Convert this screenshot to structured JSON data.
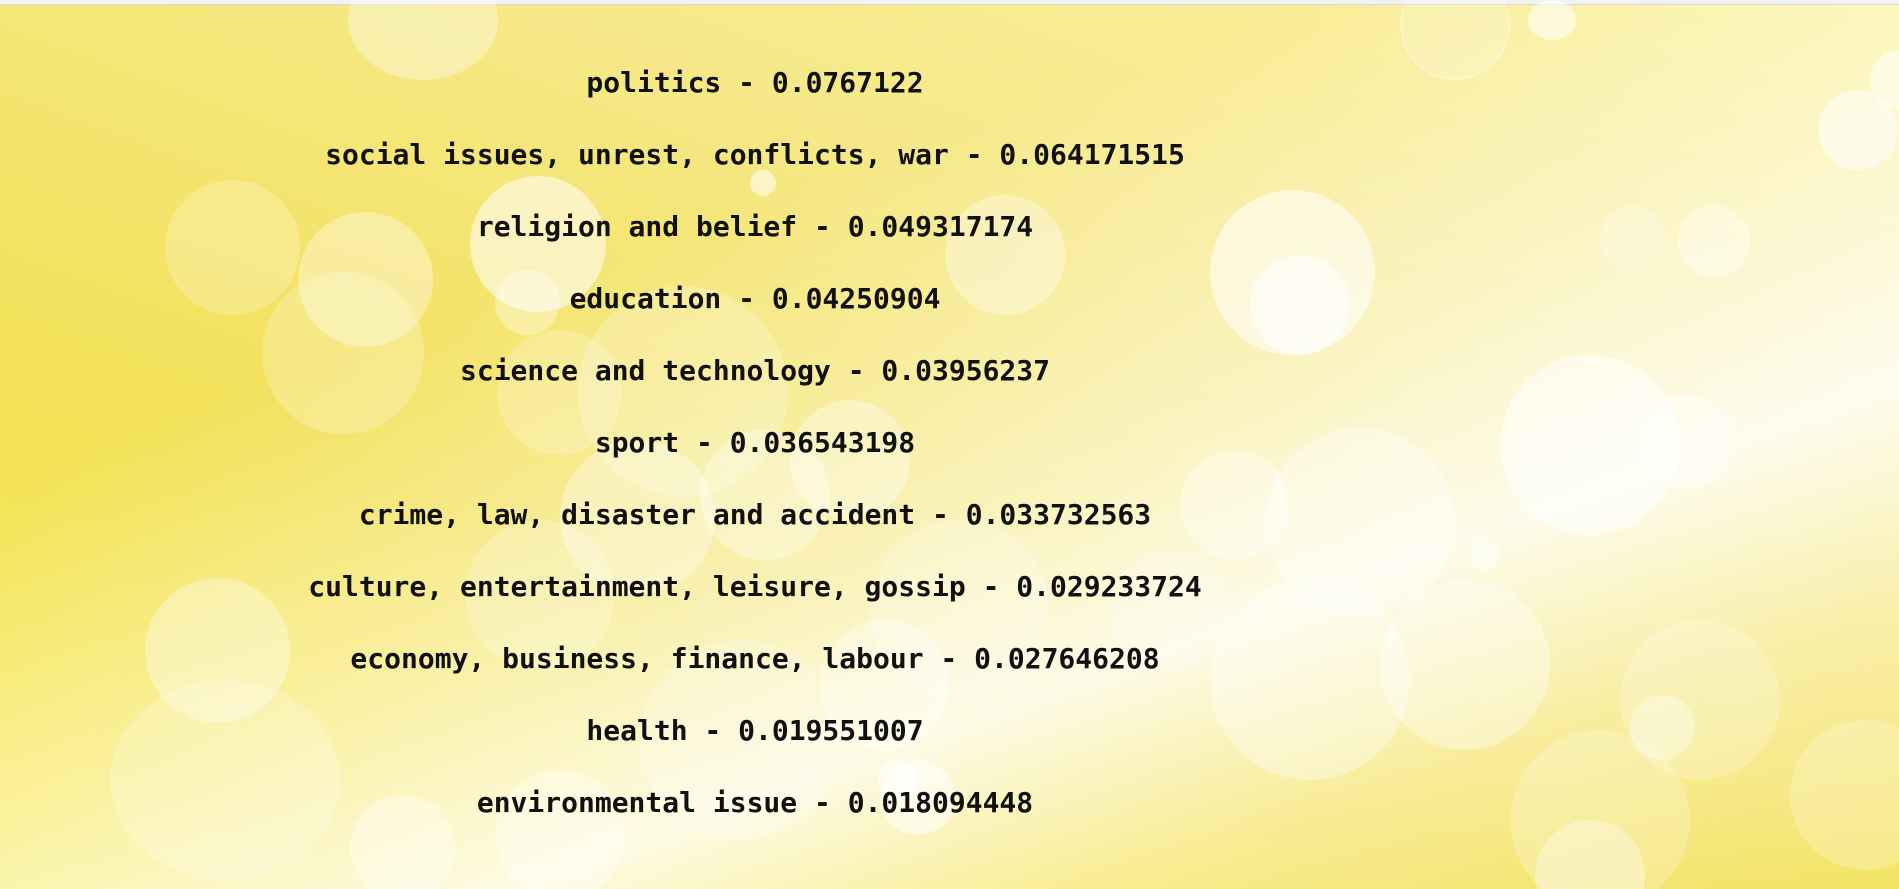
{
  "topics": [
    {
      "text": "politics - 0.0767122"
    },
    {
      "text": "social issues, unrest, conflicts, war - 0.064171515"
    },
    {
      "text": "religion and belief - 0.049317174"
    },
    {
      "text": "education - 0.04250904"
    },
    {
      "text": "science and technology - 0.03956237"
    },
    {
      "text": "sport - 0.036543198"
    },
    {
      "text": "crime, law, disaster and accident - 0.033732563"
    },
    {
      "text": "culture, entertainment, leisure, gossip - 0.029233724"
    },
    {
      "text": "economy, business, finance, labour - 0.027646208"
    },
    {
      "text": "health - 0.019551007"
    },
    {
      "text": "environmental issue - 0.018094448"
    }
  ]
}
